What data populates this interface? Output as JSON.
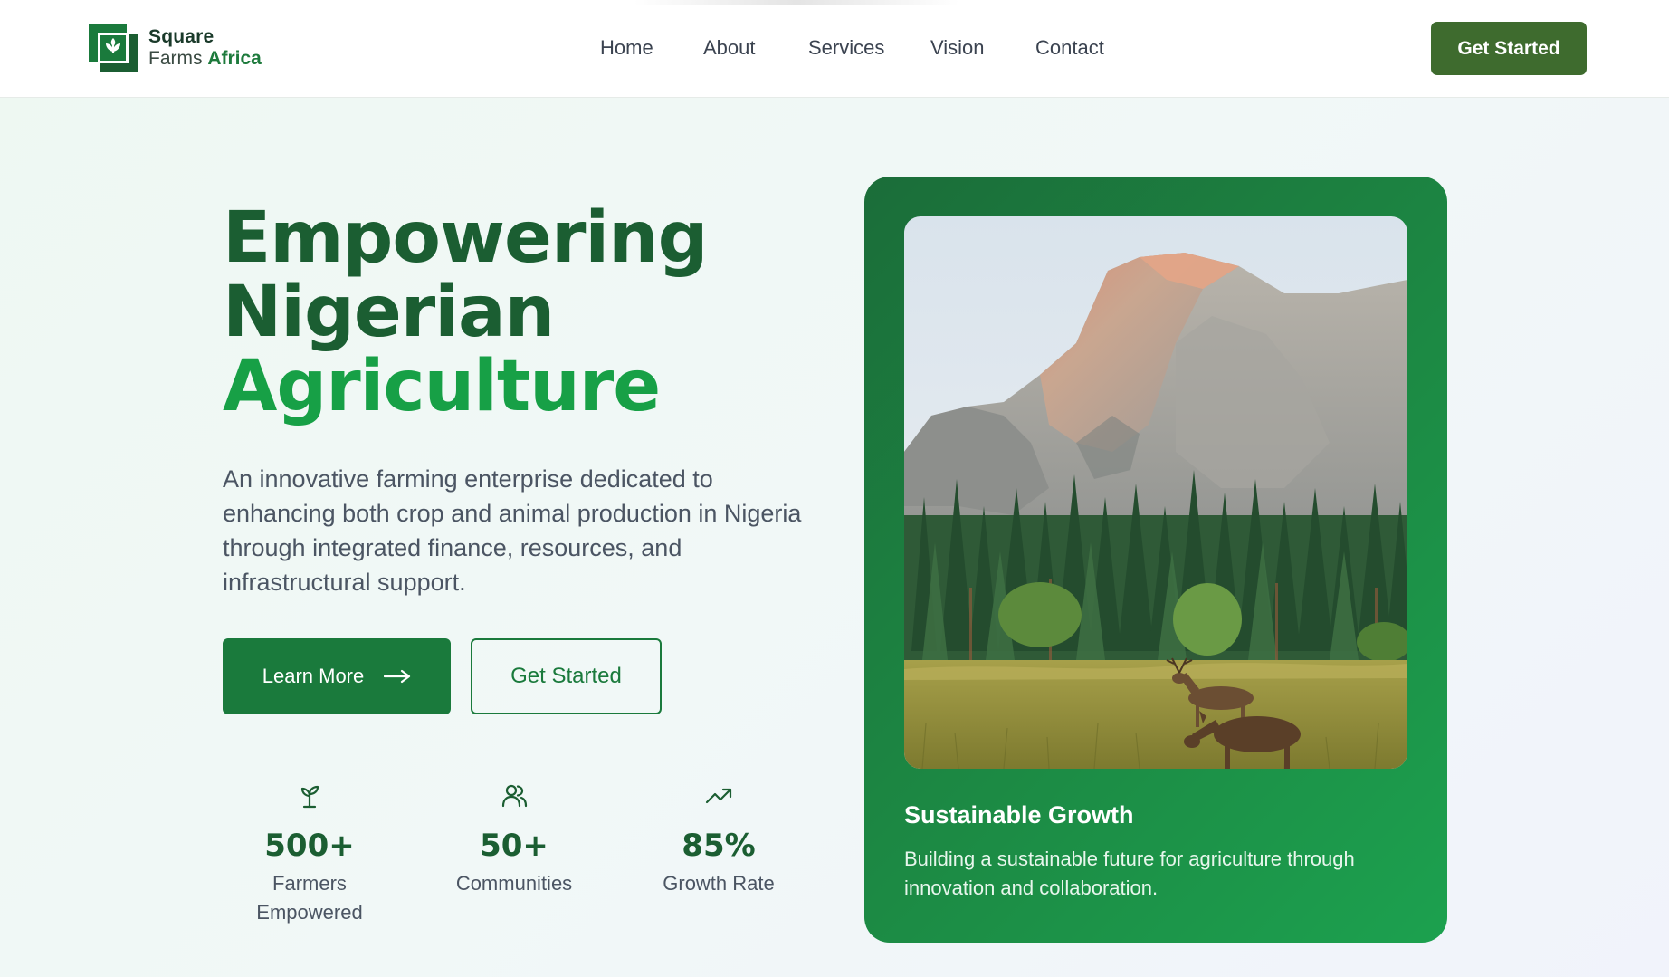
{
  "brand": {
    "name_line1": "Square",
    "name_line2_plain": "Farms ",
    "name_line2_accent": "Africa",
    "logo_icon": "leaf-shield-logo",
    "primary_color": "#1a7a3c",
    "accent_color": "#17a046",
    "dark_color": "#1b5e32"
  },
  "nav": {
    "items": [
      {
        "label": "Home"
      },
      {
        "label": "About"
      },
      {
        "label": "Services"
      },
      {
        "label": "Vision"
      },
      {
        "label": "Contact"
      }
    ],
    "cta_label": "Get Started"
  },
  "hero": {
    "headline_line1": "Empowering",
    "headline_line2": "Nigerian",
    "headline_line3": "Agriculture",
    "description": "An innovative farming enterprise dedicated to enhancing both crop and animal production in Nigeria through integrated finance, resources, and infrastructural support.",
    "primary_button": {
      "label": "Learn More",
      "icon": "arrow-right-icon"
    },
    "secondary_button": {
      "label": "Get Started"
    }
  },
  "stats": [
    {
      "icon": "sprout-icon",
      "value": "500+",
      "label_line1": "Farmers",
      "label_line2": "Empowered"
    },
    {
      "icon": "users-icon",
      "value": "50+",
      "label_line1": "Communities",
      "label_line2": ""
    },
    {
      "icon": "trending-up-icon",
      "value": "85%",
      "label_line1": "Growth Rate",
      "label_line2": ""
    }
  ],
  "card": {
    "image_subject": "mountain-valley-with-deer",
    "title": "Sustainable Growth",
    "text": "Building a sustainable future for agriculture through innovation and collaboration."
  }
}
